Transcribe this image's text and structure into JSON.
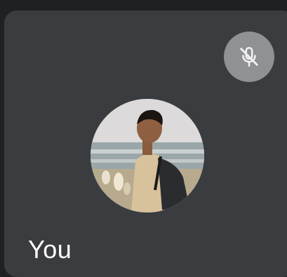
{
  "participant": {
    "name": "You",
    "mic_state_icon": "mic-off-icon",
    "avatar_kind": "profile-photo"
  },
  "colors": {
    "page_background": "#1f2022",
    "tile_background": "#3a3c40",
    "indicator_background": "#8f9194",
    "name_text": "#ffffff"
  }
}
